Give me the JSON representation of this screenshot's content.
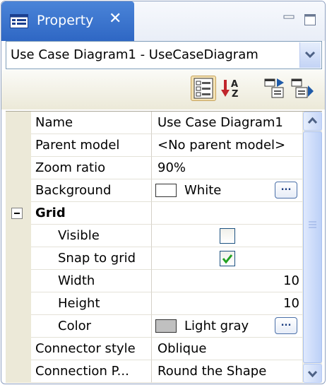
{
  "panel": {
    "tab_title": "Property",
    "tab_icon": "property-sheet-icon",
    "close_glyph": "✕",
    "minimize_icon": "minimize-icon",
    "maximize_icon": "maximize-icon"
  },
  "selector": {
    "selected": "Use Case Diagram1 - UseCaseDiagram",
    "icon": "chevron-down-icon"
  },
  "toolbar": {
    "buttons": [
      {
        "name": "categories-view-button",
        "icon": "categories-icon",
        "active": true
      },
      {
        "name": "sort-alphabetical-button",
        "icon": "sort-az-icon",
        "active": false
      },
      {
        "name": "expand-all-button",
        "icon": "expand-all-icon",
        "active": false
      },
      {
        "name": "collapse-all-button",
        "icon": "collapse-all-icon",
        "active": false
      }
    ]
  },
  "properties": {
    "name": {
      "label": "Name",
      "value": "Use Case Diagram1"
    },
    "parent_model": {
      "label": "Parent model",
      "value": "<No parent model>"
    },
    "zoom_ratio": {
      "label": "Zoom ratio",
      "value": "90%"
    },
    "background": {
      "label": "Background",
      "value": "White",
      "swatch": "#ffffff",
      "button": "..."
    },
    "grid": {
      "label": "Grid",
      "expanded": true,
      "visible": {
        "label": "Visible",
        "checked": false
      },
      "snap_to_grid": {
        "label": "Snap to grid",
        "checked": true
      },
      "width": {
        "label": "Width",
        "value": "10"
      },
      "height": {
        "label": "Height",
        "value": "10"
      },
      "color": {
        "label": "Color",
        "value": "Light gray",
        "swatch": "#c0c0c0",
        "button": "..."
      }
    },
    "connector_style": {
      "label": "Connector style",
      "value": "Oblique"
    },
    "connection_point": {
      "label": "Connection P...",
      "value": "Round the Shape"
    }
  },
  "colors": {
    "tab_active": "#3a72cf",
    "toolbar_bg": "#ece9d8",
    "checkmark": "#21a121",
    "scrollbar": "#c6d6f7"
  }
}
